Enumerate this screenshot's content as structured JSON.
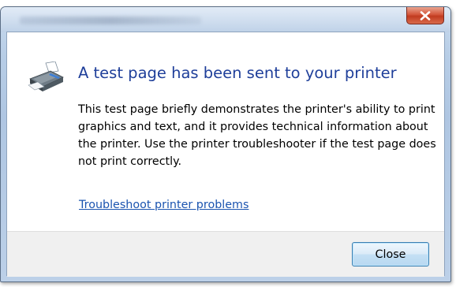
{
  "window": {
    "title": "",
    "close_icon": "close-x-icon"
  },
  "dialog": {
    "icon": "printer-icon",
    "heading": "A test page has been sent to your printer",
    "body": "This test page briefly demonstrates the printer's ability to print graphics and text, and it provides technical information about the printer.  Use the printer troubleshooter if the test page does not print correctly.",
    "link_label": "Troubleshoot printer problems"
  },
  "footer": {
    "close_label": "Close"
  },
  "colors": {
    "heading": "#1f3f9a",
    "link": "#1b54b0",
    "close_button_red": "#c13b20"
  }
}
